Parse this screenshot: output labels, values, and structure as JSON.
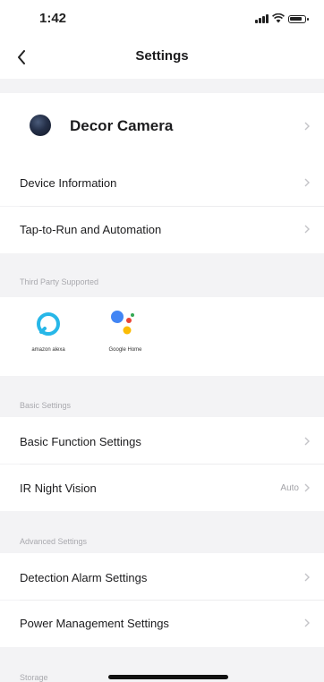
{
  "status_bar": {
    "time": "1:42"
  },
  "nav": {
    "title": "Settings"
  },
  "device": {
    "name": "Decor Camera"
  },
  "rows": {
    "device_information": "Device Information",
    "tap_to_run": "Tap-to-Run and Automation",
    "basic_function": "Basic Function Settings",
    "ir_night_vision": "IR Night Vision",
    "ir_night_vision_value": "Auto",
    "detection_alarm": "Detection Alarm Settings",
    "power_management": "Power Management Settings"
  },
  "sections": {
    "third_party": "Third Party Supported",
    "basic_settings": "Basic Settings",
    "advanced_settings": "Advanced Settings",
    "storage": "Storage"
  },
  "third_party_services": [
    {
      "label": "amazon alexa",
      "icon": "alexa-icon"
    },
    {
      "label": "Google Home",
      "icon": "google-assistant-icon"
    }
  ]
}
